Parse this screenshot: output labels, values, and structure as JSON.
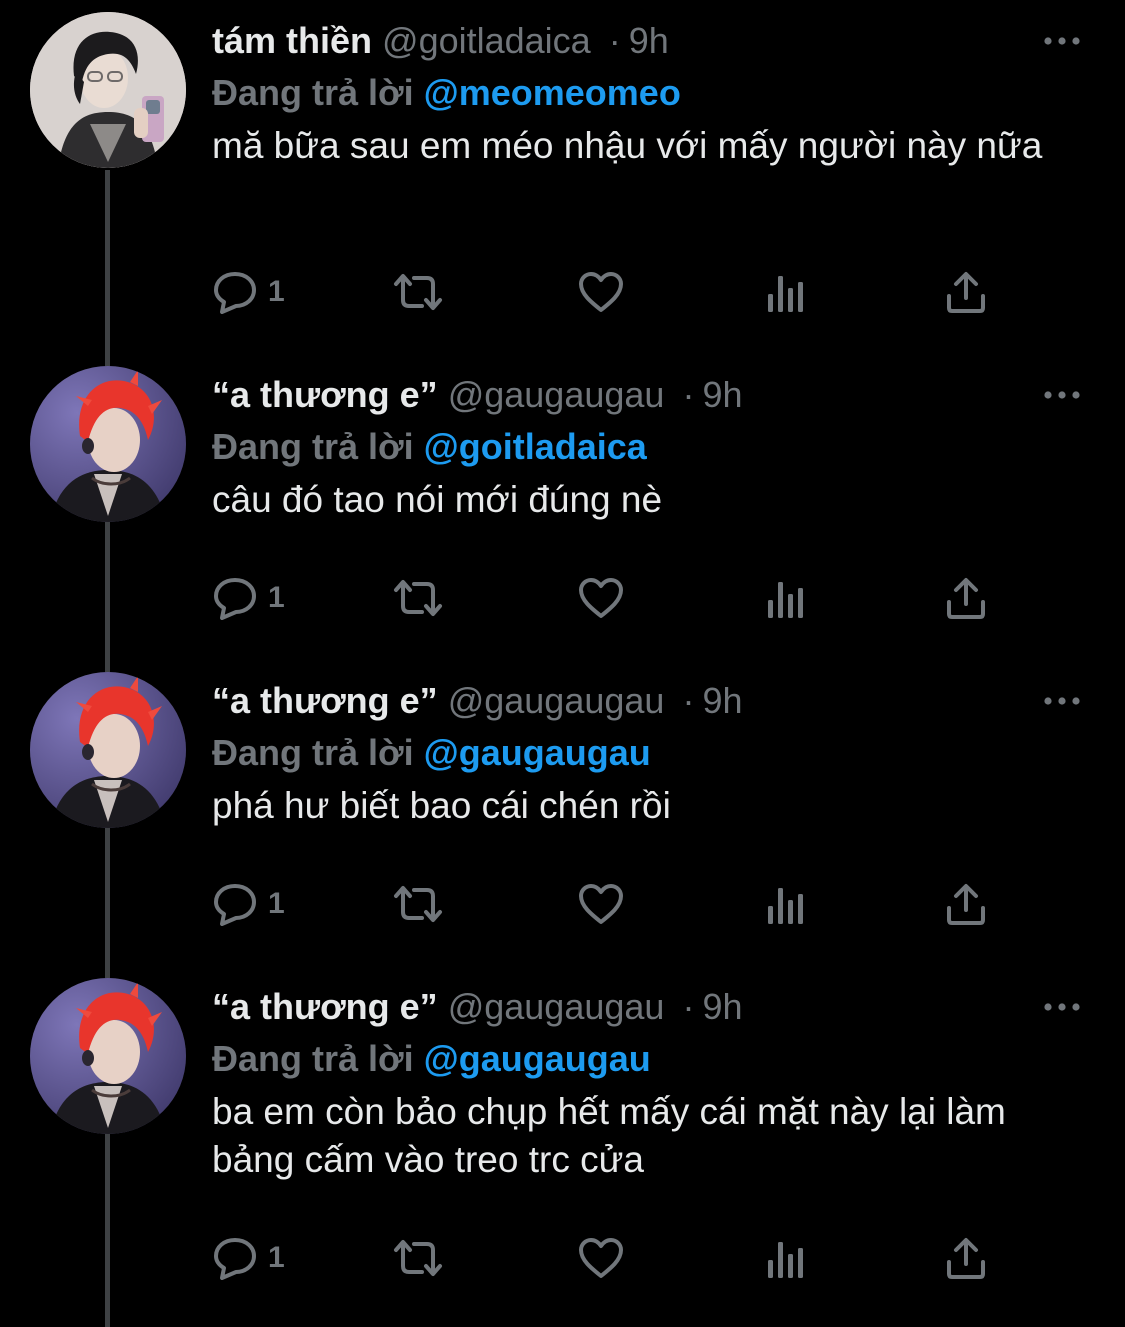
{
  "colors": {
    "background": "#000000",
    "text_primary": "#e7e9ea",
    "text_secondary": "#71767b",
    "accent": "#1d9bf0",
    "thread_line": "#3e4144"
  },
  "tweets": [
    {
      "display_name": "tám thiền",
      "handle": "@goitladaica",
      "separator": "·",
      "time": "9h",
      "reply_label": "Đang trả lời",
      "reply_to": "@meomeomeo",
      "text": "mă bữa sau em méo nhậu với mấy người này nữa",
      "reply_count": "1",
      "avatar": "avatar-dark-hair",
      "icons": [
        "more-icon",
        "reply-icon",
        "retweet-icon",
        "like-icon",
        "views-icon",
        "share-icon"
      ]
    },
    {
      "display_name": "“a thương e”",
      "handle": "@gaugaugau",
      "separator": "·",
      "time": "9h",
      "reply_label": "Đang trả lời",
      "reply_to": "@goitladaica",
      "text": "câu đó tao nói mới đúng nè",
      "reply_count": "1",
      "avatar": "avatar-red-hair"
    },
    {
      "display_name": "“a thương e”",
      "handle": "@gaugaugau",
      "separator": "·",
      "time": "9h",
      "reply_label": "Đang trả lời",
      "reply_to": "@gaugaugau",
      "text": "phá hư biết bao cái chén rồi",
      "reply_count": "1",
      "avatar": "avatar-red-hair"
    },
    {
      "display_name": "“a thương e”",
      "handle": "@gaugaugau",
      "separator": "·",
      "time": "9h",
      "reply_label": "Đang trả lời",
      "reply_to": "@gaugaugau",
      "text": "ba em còn bảo chụp hết mấy cái mặt này lại làm bảng cấm vào treo trc cửa",
      "reply_count": "1",
      "avatar": "avatar-red-hair"
    }
  ]
}
